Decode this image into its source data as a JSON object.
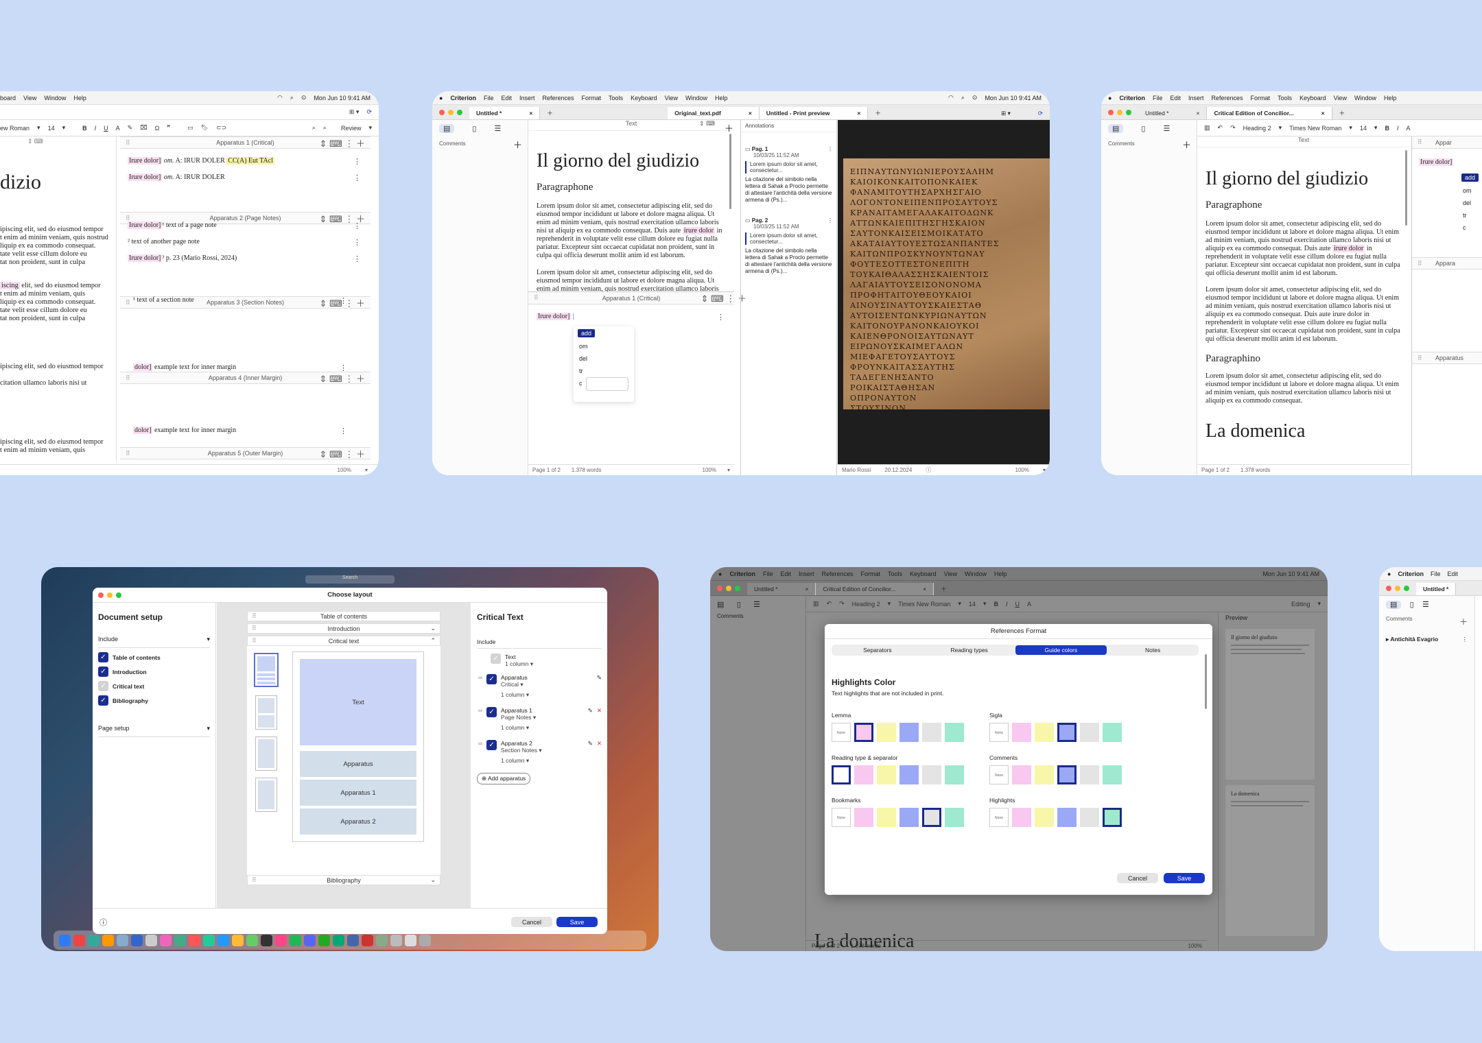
{
  "bg_color": "#c9dbf6",
  "menu": {
    "app": "Criterion",
    "file": "File",
    "edit": "Edit",
    "insert": "Insert",
    "references": "References",
    "format": "Format",
    "tools": "Tools",
    "keyboard": "Keyboard",
    "view": "View",
    "window": "Window",
    "help": "Help",
    "clock": "Mon Jun 10  9:41 AM"
  },
  "w1": {
    "menu_partial": "board",
    "font": "ew Roman",
    "size": "14",
    "mode": "Review",
    "title_partial": "dizio",
    "sec1": "Apparatus 1 (Critical)",
    "sec2": "Apparatus 2 (Page Notes)",
    "sec3": "Apparatus 3 (Section Notes)",
    "sec4": "Apparatus 4 (Inner Margin)",
    "sec5": "Apparatus 5 (Outer Margin)",
    "app1_line1_lemma": "Irure dolor]",
    "app1_line1_mid": "om.",
    "app1_line1_a": "A",
    "app1_line1_rest": ": IRUR DOLER",
    "app1_line1_tail": "CC(A) Eut TAcl",
    "app1_line2_lemma": "Irure dolor]",
    "app1_line2_mid": "om.",
    "app1_line2_a": "A",
    "app1_line2_rest": ": IRUR DOLER",
    "pn1_lemma": "Irure dolor]",
    "pn1_text": "¹ text of a page note",
    "pn2_text": "² text of another page note",
    "pn3_lemma": "Irure dolor]",
    "pn3_text": "³ p. 23 (Mario Rossi, 2024)",
    "sn1_text": "¹ text of a section note",
    "im_lemma": "dolor]",
    "im_text": "example text for inner margin",
    "om_lemma": "dolor]",
    "om_text": "example text for inner margin",
    "p1": [
      "ipiscing elit, sed do eiusmod tempor",
      "t enim ad minim veniam, quis nostrud",
      "liquip ex ea commodo consequat.",
      "tate velit esse cillum dolore eu",
      "tat non proident, sunt in culpa"
    ],
    "p2a": "iscing",
    "p2": [
      " elit, sed do eiusmod tempor",
      "t enim ad minim veniam, quis",
      "liquip ex ea commodo consequat.",
      "tate velit esse cillum dolore eu",
      "tat non proident, sunt in culpa"
    ],
    "p3": [
      "ipiscing elit, sed do eiusmod tempor",
      "citation ullamco laboris nisi ut"
    ],
    "p4": [
      "ipiscing elit, sed do eiusmod tempor",
      "t enim ad minim veniam, quis"
    ],
    "zoom": "100%"
  },
  "w2": {
    "tab1": "Untitled *",
    "tab2": "Original_text.pdf",
    "tab3": "Untitled - Print preview",
    "comments": "Comments",
    "text_label": "Text",
    "annotations": "Annotations",
    "title": "Il giorno del giudizio",
    "subtitle": "Paragraphone",
    "para1": "Lorem ipsum dolor sit amet, consectetur adipiscing elit, sed do eiusmod tempor incididunt ut labore et dolore magna aliqua. Ut enim ad minim veniam, quis nostrud exercitation ullamco laboris nisi ut aliquip ex ea commodo consequat. Duis aute",
    "para1_hl": "irure dolor",
    "para1_end": "in reprehenderit in voluptate velit esse cillum dolore eu fugiat nulla pariatur. Excepteur sint occaecat cupidatat non proident, sunt in culpa qui officia deserunt mollit anim id est laborum.",
    "para2": "Lorem ipsum dolor sit amet, consectetur adipiscing elit, sed do eiusmod tempor incididunt ut labore et dolore magna aliqua. Ut enim ad minim veniam, quis nostrud exercitation ullamco laboris",
    "app_label": "Apparatus 1 (Critical)",
    "app_lemma": "Irure dolor]",
    "dd": [
      "add",
      "om",
      "del",
      "tr",
      "c"
    ],
    "ann1_title": "Pag. 1",
    "ann1_date": "10/03/25 11:52 AM",
    "ann1_quote": "Lorem ipsum dolor sit amet, consectetur...",
    "ann1_body": "La citazione del simbolo nella lettera di Sahak a Proclo permette di attestare l'antichità della versione armena di (Ps.)...",
    "ann2_title": "Pag. 2",
    "ann2_date": "10/03/25 11:52 AM",
    "ann2_quote": "Lorem ipsum dolor sit amet, consectetur...",
    "ann2_body": "La citazione del simbolo nella lettera di Sahak a Proclo permette di attestare l'antichità della versione armena di (Ps.)...",
    "page": "Page 1 of 2",
    "words": "1.378 words",
    "zoom": "100%",
    "author": "Mario Rossi",
    "date": "20.12.2024",
    "zoom2": "100%",
    "manuscript": [
      "ΕΙΠΝΑΥΤΩΝΥΙΩΝΙΕΡΟΥΣΑΛΗΜ",
      "ΚΑΙΟΙΚΟΝΚΑΙΤΟΠΟΝΚΑΙΕΚ",
      "ΦΑΝΑΜΙΤΟΥΤΗΣΑΡΧΗΣΓΑΙΟ",
      "ΛΟΓΟΝΤΟΝΕΙΠΕΝΠΡΟΣΑΥΤΟΥΣ",
      "ΚΡΑΝΑΙΤΑΜΕΓΑΛΑΚΑΙΤΟΔΩΝΚ",
      "ΑΤΤΩΝΚΑΙΕΠΙΤΗΣΓΗΣΚΑΙΟΝ",
      "ΣΑΥΤΟΝΚΑΙΣΕΙΣΜΟΙΚΑΤΑΤΟ",
      "ΑΚΑΤΑΙΑΥΤΟΥΕΣΤΩΣΑΝΠΑΝΤΕΣ",
      "ΚΑΙΤΩΝΠΡΟΣΚΥΝΟΥΝΤΩΝΑΥ",
      "ΦΟΥΤΕΣΟΤΤΕΣΤΟΝΕΠΙΤΗ",
      "ΤΟΥΚΑΙΘΑΛΑΣΣΗΣΚΑΙΕΝΤΟΙΣ",
      "ΛΑΓΑΙΑΥΤΟΥΣΕΙΣΟΝΟΝΟΜΑ",
      "ΠΡΟΦΗΤΑΙΤΟΥΘΕΟΥΚΑΙΟΙ",
      "ΑΙΝΟΥΣΙΝΑΥΤΟΥΣΚΑΙΕΣΤΑΘ",
      "ΑΥΤΟΙΣΕΝΤΩΝΚΥΡΙΩΝΑΥΤΩΝ",
      "ΚΑΙΤΟΝΟΥΡΑΝΟΝΚΑΙΟΥΚΟΙ",
      "ΚΑΙΕΝΘΡΟΝΟΙΣΑΥΤΩΝΑΥΤ",
      "ΕΙΡΩΝΟΥΣΚΑΙΜΕΓΑΛΩΝ",
      "ΜΙΕΦΑΓΕΤΟΥΣΑΥΤΟΥΣ",
      "ΦΡΟΥΝΚΑΙΤΑΣΣΑΥΤΗΣ",
      "ΤΑΔΕΓΕΝΗΣΑΝΤΟ",
      "ΡΟΙΚΑΙΣΤΑΘΗΣΑΝ",
      "ΟΠΡΟΝΑΥΤΟΝ",
      "ΣΤΟΥΣΙΝΟΝ"
    ]
  },
  "w3": {
    "tab1": "Untitled *",
    "tab2": "Critical Edition of Concilior...",
    "comments": "Comments",
    "style": "Heading 2",
    "font": "Times New Roman",
    "size": "14",
    "text_label": "Text",
    "appar_partial": "Appar",
    "title": "Il giorno del giudizio",
    "subtitle": "Paragraphone",
    "para1": "Lorem ipsum dolor sit amet, consectetur adipiscing elit, sed do eiusmod tempor incididunt ut labore et dolore magna aliqua. Ut enim ad minim veniam, quis nostrud exercitation ullamco laboris nisi ut aliquip ex ea commodo consequat. Duis aute",
    "para1_hl": "irure dolor",
    "para1_end": "in reprehenderit in voluptate velit esse cillum dolore eu fugiat nulla pariatur. Excepteur sint occaecat cupidatat non proident, sunt in culpa qui officia deserunt mollit anim id est laborum.",
    "para2": "Lorem ipsum dolor sit amet, consectetur adipiscing elit, sed do eiusmod tempor incididunt ut labore et dolore magna aliqua. Ut enim ad minim veniam, quis nostrud exercitation ullamco laboris nisi ut aliquip ex ea commodo consequat. Duis aute irure dolor in reprehenderit in voluptate velit esse cillum dolore eu fugiat nulla pariatur. Excepteur sint occaecat cupidatat non proident, sunt in culpa qui officia deserunt mollit anim id est laborum.",
    "h2": "Paragraphino",
    "para3": "Lorem ipsum dolor sit amet, consectetur adipiscing elit, sed do eiusmod tempor incididunt ut labore et dolore magna aliqua. Ut enim ad minim veniam, quis nostrud exercitation ullamco laboris nisi ut aliquip ex ea commodo consequat.",
    "h1b": "La domenica",
    "lemma": "Irure dolor]",
    "dd": [
      "add",
      "om",
      "del",
      "tr",
      "c"
    ],
    "appar2": "Appara",
    "appar3": "Apparatus",
    "page": "Page 1 of 2",
    "words": "1.378 words"
  },
  "w4": {
    "search": "Search",
    "dialog_title": "Choose layout",
    "setup": "Document setup",
    "include": "Include",
    "inc": [
      "Table of contents",
      "Introduction",
      "Critical text",
      "Bibliography"
    ],
    "page_setup": "Page setup",
    "bars": [
      "Table of contents",
      "Introduction",
      "Critical text"
    ],
    "bib": "Bibliography",
    "blk_text": "Text",
    "blk_app": "Apparatus",
    "blk_app1": "Apparatus 1",
    "blk_app2": "Apparatus 2",
    "rp_title": "Critical Text",
    "rp_include": "Include",
    "r_text": "Text",
    "r_text_sub": "1 column",
    "r_app": "Apparatus",
    "r_app_sub1": "Critical",
    "r_app_sub2": "1 column",
    "r_app1": "Apparatus 1",
    "r_app1_sub1": "Page Notes",
    "r_app1_sub2": "1 column",
    "r_app2": "Apparatus 2",
    "r_app2_sub1": "Section Notes",
    "r_app2_sub2": "1 column",
    "add_app": "Add apparatus",
    "cancel": "Cancel",
    "save": "Save"
  },
  "w5": {
    "tab1": "Untitled *",
    "tab2": "Critical Edition of Concilior...",
    "comments": "Comments",
    "style": "Heading 2",
    "font": "Times New Roman",
    "size": "14",
    "mode": "Editing",
    "preview": "Preview",
    "dlg_title": "References Format",
    "seg": [
      "Separators",
      "Reading types",
      "Guide colors",
      "Notes"
    ],
    "hc_title": "Highlights Color",
    "hc_sub": "Text highlights that are not included in print.",
    "groups": [
      "Lemma",
      "Sigla",
      "Reading type & separator",
      "Comments",
      "Bookmarks",
      "Highlights"
    ],
    "none": "None",
    "cancel": "Cancel",
    "save": "Save",
    "h1b": "La domenica",
    "page": "Page 1 of 2",
    "words": "1.378 words",
    "zoom": "100%",
    "pv_title": "Il giorno del giudizio",
    "pv_h2": "La domenica",
    "colors": [
      "#ffffff",
      "#f9c8f0",
      "#f8f6a8",
      "#9aa8f5",
      "#e4e4e4",
      "#9ee9d0"
    ]
  },
  "w6": {
    "tab1": "Untitled *",
    "comments": "Comments",
    "item": "Antichità Evagrio",
    "app": "Criterion",
    "file": "File",
    "edit": "Edit"
  }
}
